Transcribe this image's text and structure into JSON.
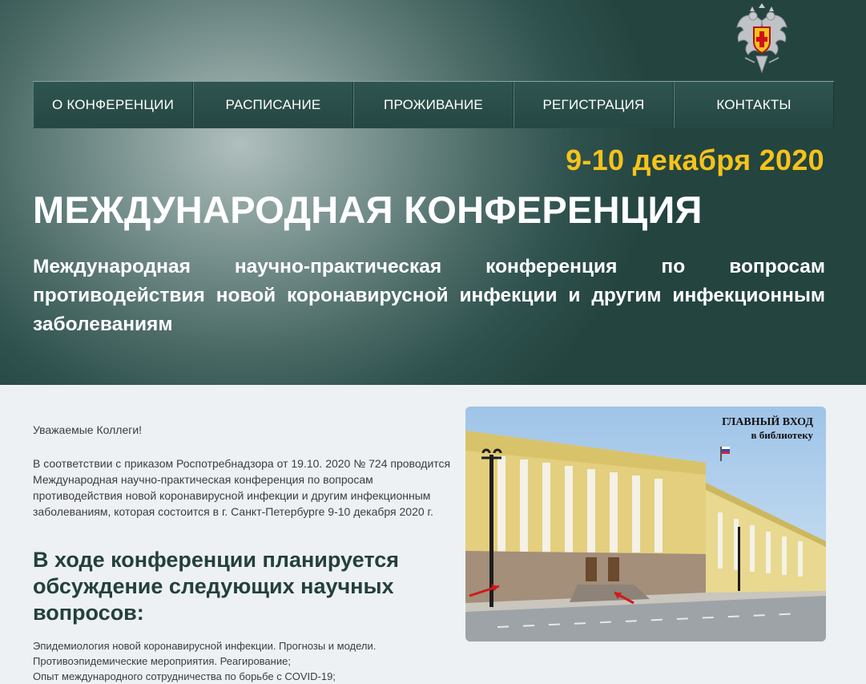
{
  "header": {
    "emblem": "double-headed-eagle-emblem",
    "nav": [
      {
        "label": "О КОНФЕРЕНЦИИ"
      },
      {
        "label": "РАСПИСАНИЕ"
      },
      {
        "label": "ПРОЖИВАНИЕ"
      },
      {
        "label": "РЕГИСТРАЦИЯ"
      },
      {
        "label": "КОНТАКТЫ"
      }
    ],
    "date": "9-10 декабря 2020",
    "title": "МЕЖДУНАРОДНАЯ КОНФЕРЕНЦИЯ",
    "subtitle": "Международная научно-практическая конференция по вопросам противодействия новой коронавирусной инфекции и другим инфекционным заболеваниям"
  },
  "content": {
    "greeting": "Уважаемые Коллеги!",
    "intro": "В соответствии с приказом Роспотребнадзора от 19.10. 2020 № 724 проводится Международная научно-практическая конференция по вопросам противодействия новой коронавирусной инфекции и другим инфекционным заболеваниям, которая состоится в г. Санкт-Петербурге 9-10 декабря 2020 г.",
    "section_heading": "В ходе конференции планируется обсуждение следующих научных вопросов:",
    "topics": [
      "Эпидемиология новой коронавирусной инфекции. Прогнозы и модели.",
      "Противоэпидемические мероприятия. Реагирование;",
      "Опыт международного сотрудничества по борьбе с COVID-19;"
    ]
  },
  "photo": {
    "caption_line1": "ГЛАВНЫЙ ВХОД",
    "caption_line2": "в библиотеку"
  },
  "colors": {
    "hero_dark": "#24443f",
    "nav_bg": "#2f5550",
    "date_accent": "#f6c31b",
    "heading_text": "#24403c",
    "page_bg": "#eef1f4"
  }
}
